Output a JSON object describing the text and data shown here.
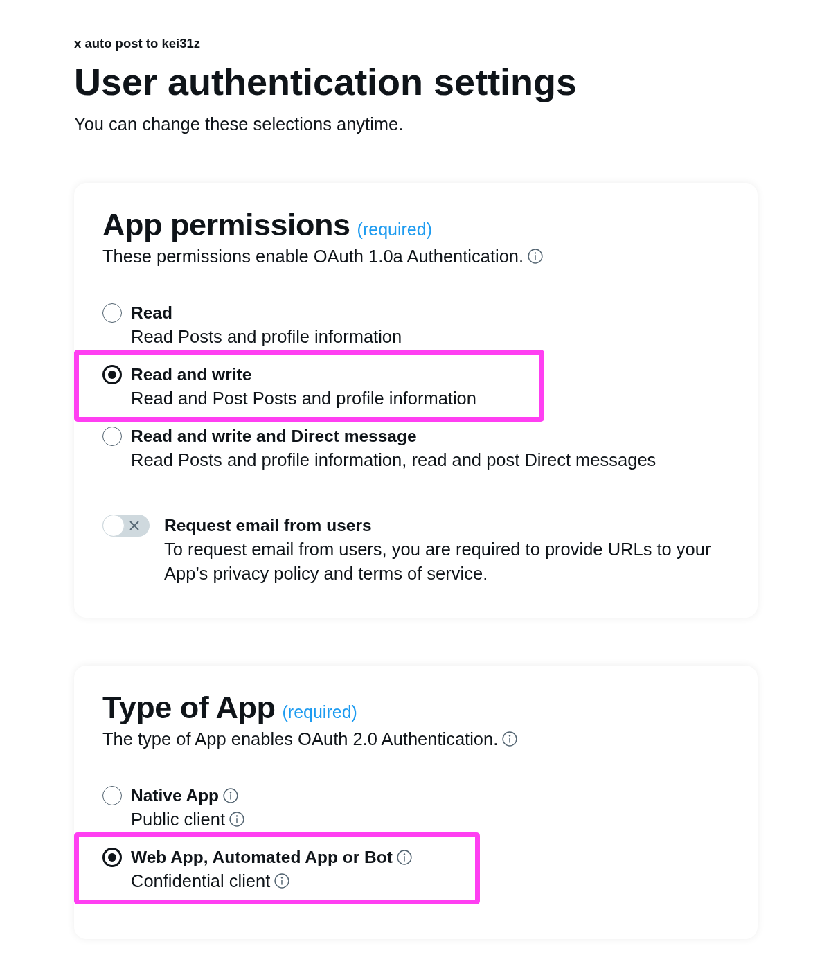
{
  "header": {
    "app_name": "x auto post to kei31z",
    "title": "User authentication settings",
    "subtitle": "You can change these selections anytime."
  },
  "sections": [
    {
      "title": "App permissions",
      "tag": "(required)",
      "description": "These permissions enable OAuth 1.0a Authentication.",
      "info": true,
      "options": [
        {
          "label": "Read",
          "description": "Read Posts and profile information",
          "selected": false,
          "highlighted": false
        },
        {
          "label": "Read and write",
          "description": "Read and Post Posts and profile information",
          "selected": true,
          "highlighted": true
        },
        {
          "label": "Read and write and Direct message",
          "description": "Read Posts and profile information, read and post Direct messages",
          "selected": false,
          "highlighted": false
        }
      ],
      "toggle": {
        "label": "Request email from users",
        "description": "To request email from users, you are required to provide URLs to your App’s privacy policy and terms of service.",
        "on": false
      }
    },
    {
      "title": "Type of App",
      "tag": "(required)",
      "description": "The type of App enables OAuth 2.0 Authentication.",
      "info": true,
      "options": [
        {
          "label": "Native App",
          "description": "Public client",
          "selected": false,
          "highlighted": false,
          "label_info": true,
          "description_info": true
        },
        {
          "label": "Web App, Automated App or Bot",
          "description": "Confidential client",
          "selected": true,
          "highlighted": true,
          "label_info": true,
          "description_info": true
        }
      ]
    }
  ]
}
